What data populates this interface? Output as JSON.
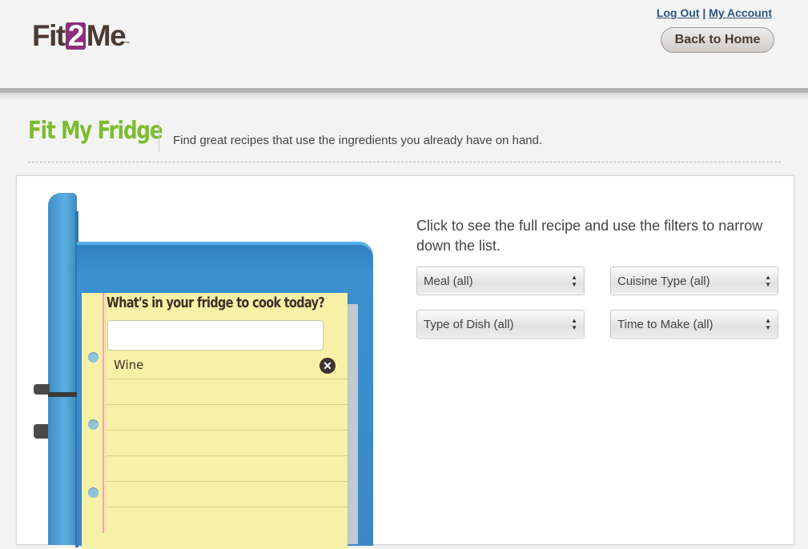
{
  "header": {
    "logo_text_left": "Fit",
    "logo_text_mid": "2",
    "logo_text_right": "Me",
    "logo_tm": "™",
    "logout_label": "Log Out",
    "separator": "|",
    "account_label": "My Account",
    "back_home_label": "Back to Home"
  },
  "page": {
    "title": "Fit My Fridge",
    "tagline": "Find great recipes that use the ingredients you already have on hand."
  },
  "notepad": {
    "title": "What's in your fridge to cook today?",
    "input_value": "",
    "items": [
      {
        "name": "Wine",
        "remove_icon": "close-circle-icon",
        "remove_glyph": "✕"
      }
    ]
  },
  "filters": {
    "instructions": "Click to see the full recipe and use the filters to narrow down the list.",
    "meal": "Meal (all)",
    "cuisine": "Cuisine Type (all)",
    "dish": "Type of Dish (all)",
    "time": "Time to Make (all)",
    "arrow_glyph_up": "▲",
    "arrow_glyph_down": "▼"
  },
  "colors": {
    "brand_purple": "#8b2f7d",
    "brand_brown": "#4b3a33",
    "title_green": "#7cbd2e",
    "link_blue": "#2c5680",
    "fridge_blue": "#3b90d0",
    "notepad_yellow": "#f6f1a6"
  }
}
